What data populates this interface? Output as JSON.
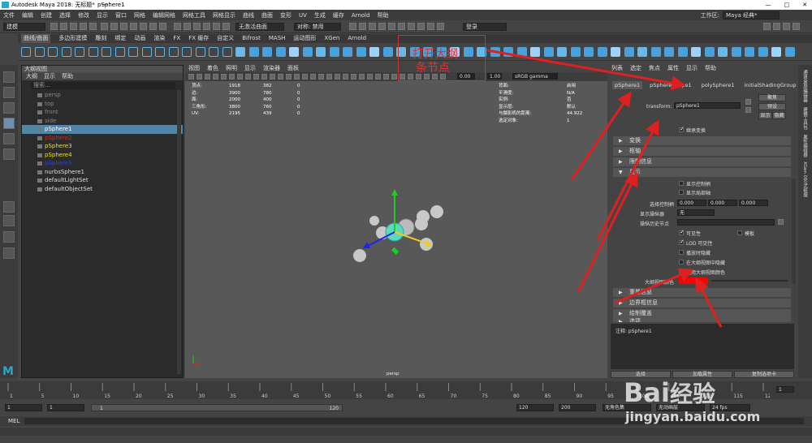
{
  "titlebar": {
    "app": "Autodesk Maya 2018: 无标题*",
    "sep": "---",
    "object": "pSphere1",
    "controls": [
      "—",
      "□",
      "✕"
    ]
  },
  "menu": [
    "文件",
    "编辑",
    "创建",
    "选择",
    "修改",
    "显示",
    "窗口",
    "网格",
    "编辑网格",
    "网格工具",
    "网格显示",
    "曲线",
    "曲面",
    "变形",
    "UV",
    "生成",
    "缓存",
    "Arnold",
    "帮助"
  ],
  "workspace": {
    "label": "工作区:",
    "value": "Maya 经典*"
  },
  "status": {
    "mode": "建模",
    "live": "无激活曲面",
    "symmetry": "对称: 禁用",
    "login": "登录"
  },
  "shelf_tabs": [
    "曲线/曲面",
    "多边形建模",
    "雕刻",
    "绑定",
    "动画",
    "渲染",
    "FX",
    "FX 缓存",
    "自定义",
    "Bifrost",
    "MASH",
    "运动图形",
    "XGen",
    "Arnold"
  ],
  "shelf_active": "曲线/曲面",
  "outliner": {
    "title": "大纲视图",
    "menu": [
      "大纲",
      "显示",
      "帮助"
    ],
    "search_placeholder": "搜索...",
    "items": [
      {
        "name": "persp",
        "color": "#888"
      },
      {
        "name": "top",
        "color": "#888"
      },
      {
        "name": "front",
        "color": "#888"
      },
      {
        "name": "side",
        "color": "#888"
      },
      {
        "name": "pSphere1",
        "color": "#ffffff",
        "selected": true
      },
      {
        "name": "pSphere2",
        "color": "#e02020"
      },
      {
        "name": "pSphere3",
        "color": "#f0e020"
      },
      {
        "name": "pSphere4",
        "color": "#f0e020"
      },
      {
        "name": "pSphere5",
        "color": "#3040e0"
      },
      {
        "name": "nurbsSphere1",
        "color": "#dddddd"
      },
      {
        "name": "defaultLightSet",
        "color": "#dddddd"
      },
      {
        "name": "defaultObjectSet",
        "color": "#dddddd"
      }
    ]
  },
  "viewport": {
    "menu": [
      "视图",
      "着色",
      "照明",
      "显示",
      "渲染器",
      "面板"
    ],
    "exposure": "0.00",
    "gamma": "1.00",
    "colorspace": "sRGB gamma",
    "camera": "persp",
    "stats": [
      {
        "label": "顶点:",
        "a": "1918",
        "b": "382",
        "c": "0"
      },
      {
        "label": "边:",
        "a": "3900",
        "b": "780",
        "c": "0"
      },
      {
        "label": "面:",
        "a": "2000",
        "b": "400",
        "c": "0"
      },
      {
        "label": "三角形:",
        "a": "3800",
        "b": "760",
        "c": "0"
      },
      {
        "label": "UV:",
        "a": "2195",
        "b": "439",
        "c": "0"
      }
    ],
    "stats2": [
      {
        "label": "背面:",
        "value": "启用"
      },
      {
        "label": "平滑度:",
        "value": "N/A"
      },
      {
        "label": "实例:",
        "value": "否"
      },
      {
        "label": "显示层:",
        "value": "默认"
      },
      {
        "label": "与摄影机的距离:",
        "value": "44.922"
      },
      {
        "label": "选定对象:",
        "value": "1"
      }
    ]
  },
  "attr": {
    "menu": [
      "列表",
      "选定",
      "焦点",
      "属性",
      "显示",
      "帮助"
    ],
    "tabs": [
      "pSphere1",
      "pSphereShape1",
      "polySphere1",
      "initialShadingGroup"
    ],
    "transform_label": "transform:",
    "transform_value": "pSphere1",
    "buttons": [
      "聚焦",
      "预设",
      "显示",
      "隐藏"
    ],
    "vis_change": "继承变换",
    "sections": [
      "变换",
      "枢轴",
      "限制信息",
      "显示"
    ],
    "display": {
      "handle": "显示控制柄",
      "local": "显示局部轴",
      "select_handle_label": "选择控制柄",
      "sh": [
        "0.000",
        "0.000",
        "0.000"
      ],
      "manip_label": "显示操纵器",
      "manip_value": "无",
      "hist_label": "操纵历史节点",
      "visible": "可见性",
      "template": "模板",
      "lod": "LOD 可见性",
      "hide_playback": "播放时隐藏",
      "hide_outliner": "在大纲视图中隐藏",
      "use_outliner_color": "使用大纲视图颜色",
      "outliner_color_label": "大纲视图颜色",
      "outliner_color": "#ff0000"
    },
    "sections2": [
      "重量信息",
      "边界框信息",
      "绘制覆盖",
      "选项"
    ],
    "note_label": "注释: pSphere1",
    "bottom": [
      "选择",
      "加载属性",
      "复制选项卡"
    ]
  },
  "side_tabs": [
    "通道盒/层编辑器",
    "建模工具包",
    "属性编辑器",
    "XGen 交互式梳理"
  ],
  "timeline": {
    "ticks": [
      "1",
      "5",
      "10",
      "15",
      "20",
      "25",
      "30",
      "35",
      "40",
      "45",
      "50",
      "55",
      "60",
      "65",
      "70",
      "75",
      "80",
      "85",
      "90",
      "95",
      "100",
      "105",
      "110",
      "115",
      "120"
    ],
    "current": "1"
  },
  "range": {
    "start": "1",
    "start2": "1",
    "slider_start": "1",
    "slider_end": "120",
    "end": "120",
    "end2": "200",
    "char_set": "无角色集",
    "anim_layer": "无动画层",
    "fps": "24 fps"
  },
  "cmd": {
    "label": "MEL"
  },
  "annotation": {
    "line1": "打开大纲",
    "line2": "条节点"
  },
  "watermark": {
    "brand": "Bai",
    "brand2": "经验",
    "url": "jingyan.baidu.com"
  },
  "colors": {
    "arrow": "#e02020",
    "selection": "#5285a6",
    "accent": "#4aa0d8"
  }
}
